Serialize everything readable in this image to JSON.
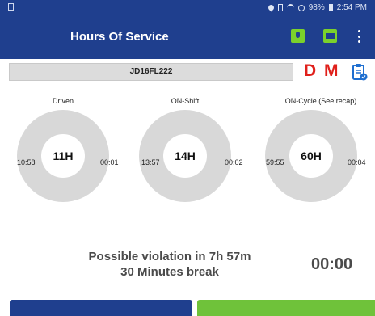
{
  "status_bar": {
    "battery": "98%",
    "time": "2:54 PM"
  },
  "header": {
    "title": "Hours Of Service"
  },
  "vehicle": {
    "id": "JD16FL222"
  },
  "indicators": {
    "d": "D",
    "m": "M"
  },
  "gauges": [
    {
      "label": "Driven",
      "left_value": "10:58",
      "center": "11H",
      "right_value": "00:01"
    },
    {
      "label": "ON-Shift",
      "left_value": "13:57",
      "center": "14H",
      "right_value": "00:02"
    },
    {
      "label": "ON-Cycle (See recap)",
      "left_value": "59:55",
      "center": "60H",
      "right_value": "00:04"
    }
  ],
  "violation": {
    "line1": "Possible violation in 7h 57m",
    "line2": "30 Minutes break",
    "timer": "00:00"
  },
  "colors": {
    "primary": "#1f3f8e",
    "accent_green": "#6fc23a",
    "alert_red": "#e0201b"
  }
}
